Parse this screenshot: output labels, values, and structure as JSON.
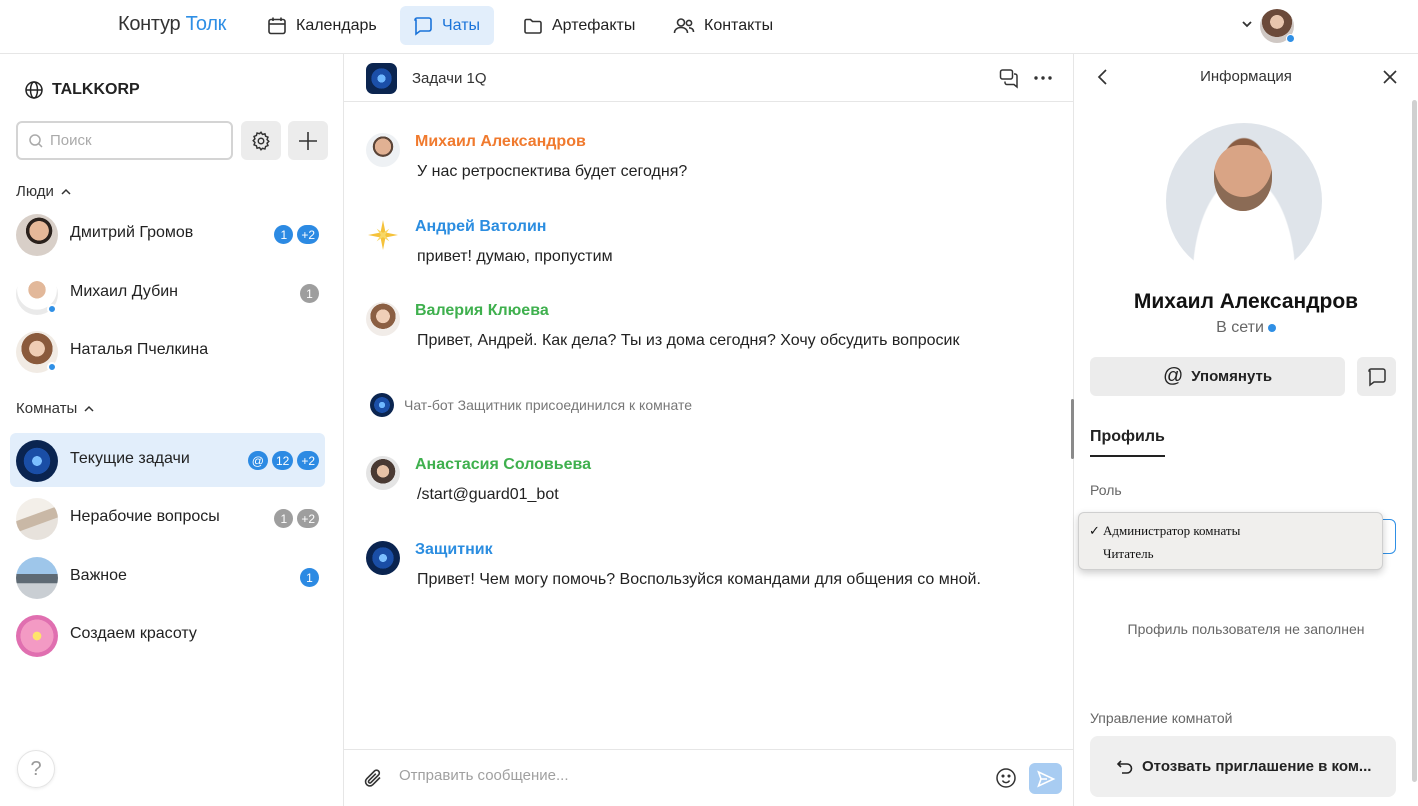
{
  "brand": {
    "part1": "Контур",
    "part2": "Толк"
  },
  "nav": [
    {
      "label": "Календарь",
      "icon": "calendar-icon"
    },
    {
      "label": "Чаты",
      "icon": "chat-icon",
      "active": true
    },
    {
      "label": "Артефакты",
      "icon": "folder-icon"
    },
    {
      "label": "Контакты",
      "icon": "contacts-icon"
    }
  ],
  "sidebar": {
    "org": "TALKKORP",
    "search_placeholder": "Поиск",
    "people_label": "Люди",
    "people": [
      {
        "name": "Дмитрий Громов",
        "badges": [
          "1",
          "+2"
        ],
        "badge_colors": [
          "blue",
          "blue"
        ],
        "online": false
      },
      {
        "name": "Михаил Дубин",
        "badges": [
          "1"
        ],
        "badge_colors": [
          "gray"
        ],
        "online": true
      },
      {
        "name": "Наталья Пчелкина",
        "badges": [],
        "badge_colors": [],
        "online": true
      }
    ],
    "rooms_label": "Комнаты",
    "rooms": [
      {
        "name": "Текущие задачи",
        "badges": [
          "@",
          "12",
          "+2"
        ],
        "badge_colors": [
          "blue",
          "blue",
          "blue"
        ],
        "active": true
      },
      {
        "name": "Нерабочие вопросы",
        "badges": [
          "1",
          "+2"
        ],
        "badge_colors": [
          "gray",
          "gray"
        ]
      },
      {
        "name": "Важное",
        "badges": [
          "1"
        ],
        "badge_colors": [
          "blue"
        ]
      },
      {
        "name": "Создаем красоту",
        "badges": [],
        "badge_colors": []
      }
    ],
    "help": "?"
  },
  "chat": {
    "title": "Задачи 1Q",
    "messages": [
      {
        "author": "Михаил Александров",
        "color": "#f07a2e",
        "text": "У нас ретроспектива будет сегодня?"
      },
      {
        "author": "Андрей Ватолин",
        "color": "#2b8de0",
        "text": "привет! думаю, пропустим"
      },
      {
        "author": "Валерия Клюева",
        "color": "#3fb04e",
        "text": "Привет, Андрей. Как дела? Ты из дома сегодня? Хочу обсудить вопросик"
      },
      {
        "author": "Анастасия Соловьева",
        "color": "#3fb04e",
        "text": "/start@guard01_bot"
      },
      {
        "author": "Защитник",
        "color": "#2b8de0",
        "text": "Привет! Чем могу помочь? Воспользуйся командами для общения со мной."
      }
    ],
    "system_message": "Чат-бот Защитник присоединился к комнате",
    "composer_placeholder": "Отправить сообщение..."
  },
  "info": {
    "title": "Информация",
    "name": "Михаил Александров",
    "status": "В сети",
    "mention_label": "Упомянуть",
    "tab": "Профиль",
    "role_label": "Роль",
    "role_options": [
      "Администратор комнаты",
      "Читатель"
    ],
    "role_selected": "Администратор комнаты",
    "empty_profile": "Профиль пользователя не заполнен",
    "manage_label": "Управление комнатой",
    "revoke_label": "Отозвать приглашение в ком..."
  },
  "colors": {
    "accent": "#2f8fe5",
    "active_bg": "#e2eefb"
  }
}
